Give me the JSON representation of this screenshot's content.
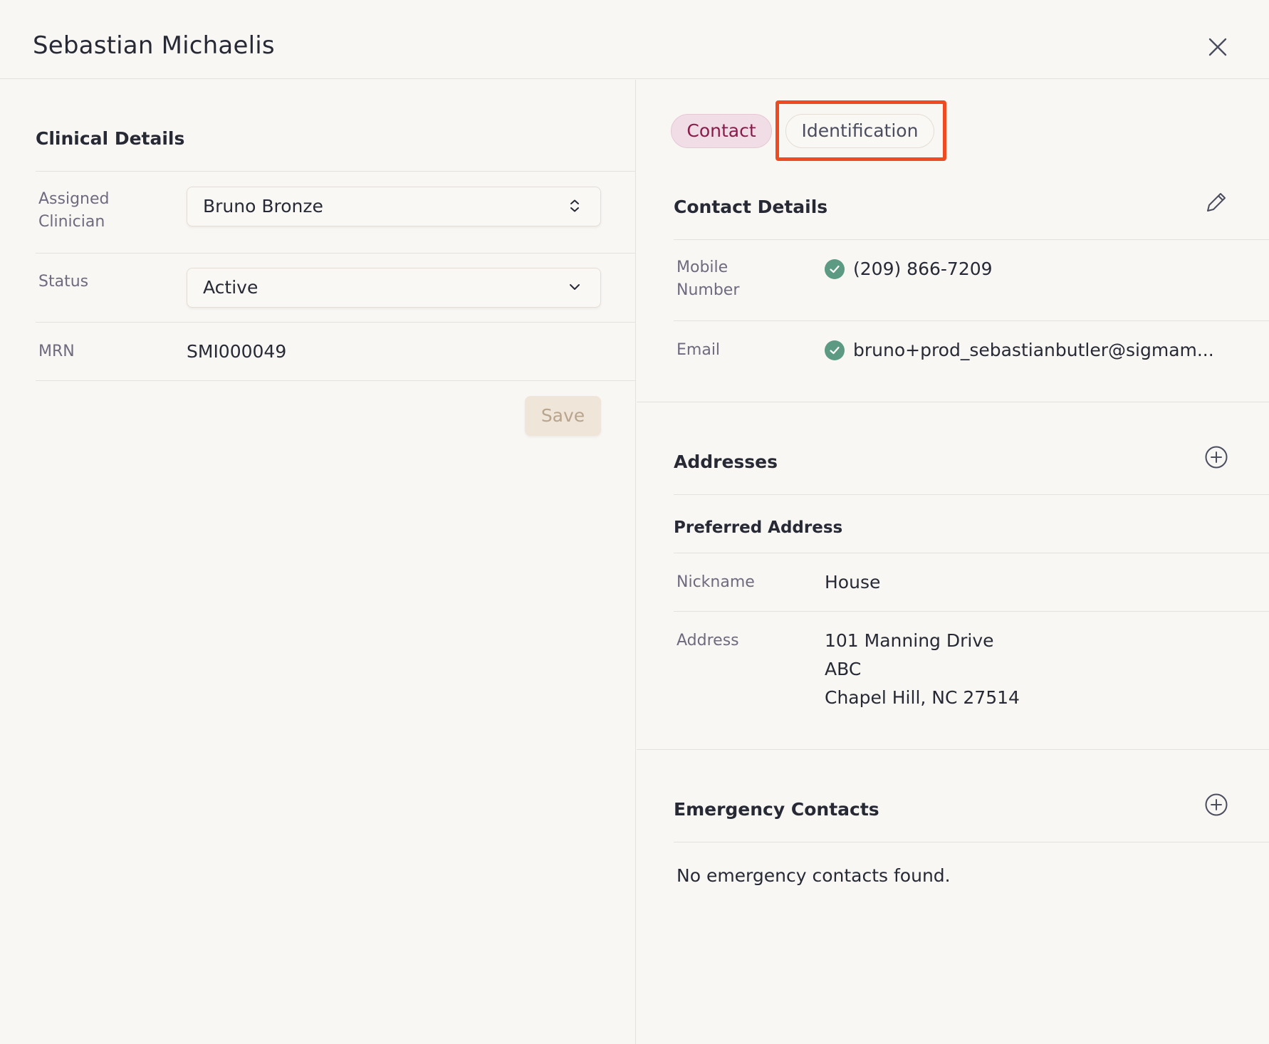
{
  "header": {
    "title": "Sebastian Michaelis"
  },
  "clinical": {
    "title": "Clinical Details",
    "assigned_clinician_label": "Assigned Clinician",
    "assigned_clinician_value": "Bruno Bronze",
    "status_label": "Status",
    "status_value": "Active",
    "mrn_label": "MRN",
    "mrn_value": "SMI000049",
    "save_label": "Save"
  },
  "tabs": [
    {
      "label": "Contact",
      "active": true
    },
    {
      "label": "Identification",
      "active": false
    }
  ],
  "contact": {
    "title": "Contact Details",
    "mobile_label": "Mobile Number",
    "mobile_value": "(209) 866-7209",
    "email_label": "Email",
    "email_value": "bruno+prod_sebastianbutler@sigmam..."
  },
  "addresses": {
    "title": "Addresses",
    "preferred_title": "Preferred Address",
    "nickname_label": "Nickname",
    "nickname_value": "House",
    "address_label": "Address",
    "address_lines": [
      "101 Manning Drive",
      "ABC",
      "Chapel Hill, NC 27514"
    ]
  },
  "emergency": {
    "title": "Emergency Contacts",
    "empty_text": "No emergency contacts found."
  },
  "colors": {
    "accent": "#8a1c4b",
    "verified": "#5c9a83",
    "highlight": "#f04a23"
  }
}
